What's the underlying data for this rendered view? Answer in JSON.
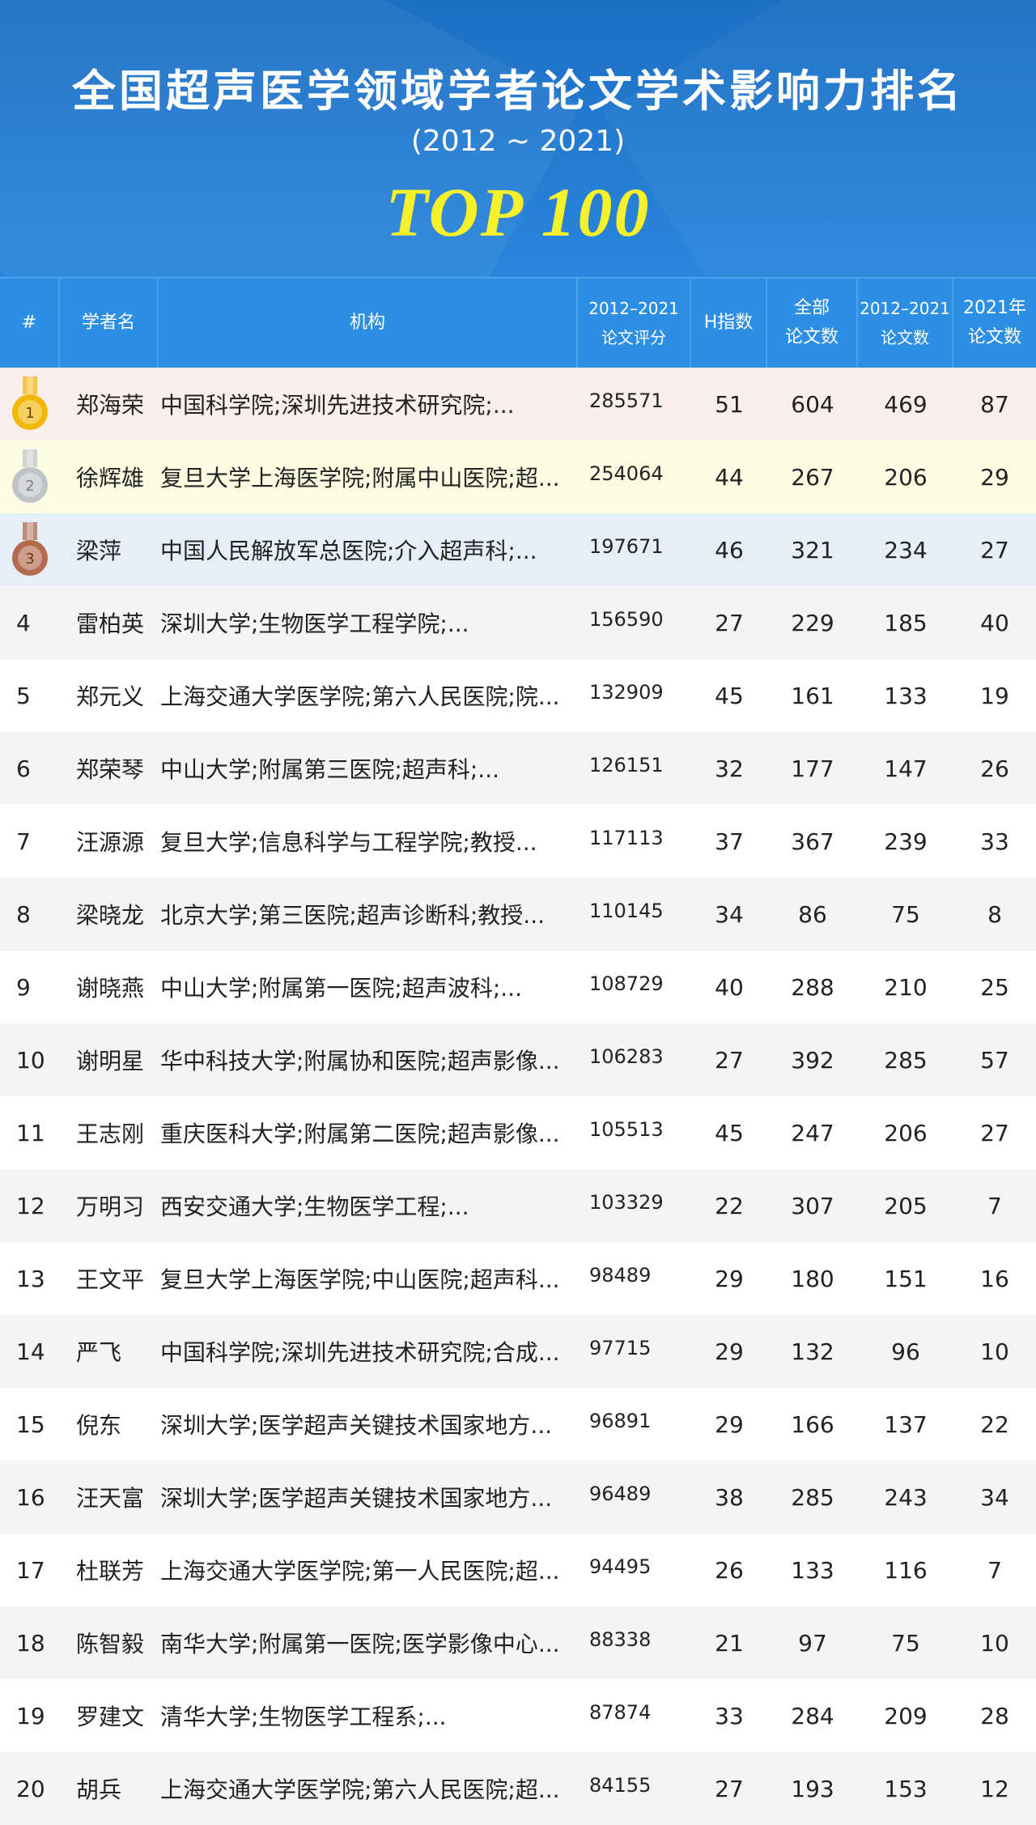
{
  "header": {
    "title": "全国超声医学领域学者论文学术影响力排名",
    "subtitle": "(2012 ~ 2021)",
    "badge": "TOP 100"
  },
  "table": {
    "columns": {
      "rank": "#",
      "name": "学者名",
      "institution": "机构",
      "score_line1": "2012–2021",
      "score_line2": "论文评分",
      "h_index": "H指数",
      "total_line1": "全部",
      "total_line2": "论文数",
      "recent_line1": "2012–2021",
      "recent_line2": "论文数",
      "y2021_line1": "2021年",
      "y2021_line2": "论文数"
    },
    "medal_colors": {
      "gold": "#f2b705",
      "silver": "#c0c4c8",
      "bronze": "#b36a4e"
    },
    "rows": [
      {
        "rank": "1",
        "medal": "gold",
        "name": "郑海荣",
        "institution": "中国科学院;深圳先进技术研究院;...",
        "score": "285571",
        "h": "51",
        "total": "604",
        "recent": "469",
        "y2021": "87"
      },
      {
        "rank": "2",
        "medal": "silver",
        "name": "徐辉雄",
        "institution": "复旦大学上海医学院;附属中山医院;超...",
        "score": "254064",
        "h": "44",
        "total": "267",
        "recent": "206",
        "y2021": "29"
      },
      {
        "rank": "3",
        "medal": "bronze",
        "name": "梁萍",
        "institution": "中国人民解放军总医院;介入超声科;...",
        "score": "197671",
        "h": "46",
        "total": "321",
        "recent": "234",
        "y2021": "27"
      },
      {
        "rank": "4",
        "name": "雷柏英",
        "institution": "深圳大学;生物医学工程学院;...",
        "score": "156590",
        "h": "27",
        "total": "229",
        "recent": "185",
        "y2021": "40"
      },
      {
        "rank": "5",
        "name": "郑元义",
        "institution": "上海交通大学医学院;第六人民医院;院...",
        "score": "132909",
        "h": "45",
        "total": "161",
        "recent": "133",
        "y2021": "19"
      },
      {
        "rank": "6",
        "name": "郑荣琴",
        "institution": "中山大学;附属第三医院;超声科;...",
        "score": "126151",
        "h": "32",
        "total": "177",
        "recent": "147",
        "y2021": "26"
      },
      {
        "rank": "7",
        "name": "汪源源",
        "institution": "复旦大学;信息科学与工程学院;教授...",
        "score": "117113",
        "h": "37",
        "total": "367",
        "recent": "239",
        "y2021": "33"
      },
      {
        "rank": "8",
        "name": "梁晓龙",
        "institution": "北京大学;第三医院;超声诊断科;教授...",
        "score": "110145",
        "h": "34",
        "total": "86",
        "recent": "75",
        "y2021": "8"
      },
      {
        "rank": "9",
        "name": "谢晓燕",
        "institution": "中山大学;附属第一医院;超声波科;...",
        "score": "108729",
        "h": "40",
        "total": "288",
        "recent": "210",
        "y2021": "25"
      },
      {
        "rank": "10",
        "name": "谢明星",
        "institution": "华中科技大学;附属协和医院;超声影像...",
        "score": "106283",
        "h": "27",
        "total": "392",
        "recent": "285",
        "y2021": "57"
      },
      {
        "rank": "11",
        "name": "王志刚",
        "institution": "重庆医科大学;附属第二医院;超声影像...",
        "score": "105513",
        "h": "45",
        "total": "247",
        "recent": "206",
        "y2021": "27"
      },
      {
        "rank": "12",
        "name": "万明习",
        "institution": "西安交通大学;生物医学工程;...",
        "score": "103329",
        "h": "22",
        "total": "307",
        "recent": "205",
        "y2021": "7"
      },
      {
        "rank": "13",
        "name": "王文平",
        "institution": "复旦大学上海医学院;中山医院;超声科...",
        "score": "98489",
        "h": "29",
        "total": "180",
        "recent": "151",
        "y2021": "16"
      },
      {
        "rank": "14",
        "name": "严飞",
        "institution": "中国科学院;深圳先进技术研究院;合成...",
        "score": "97715",
        "h": "29",
        "total": "132",
        "recent": "96",
        "y2021": "10"
      },
      {
        "rank": "15",
        "name": "倪东",
        "institution": "深圳大学;医学超声关键技术国家地方...",
        "score": "96891",
        "h": "29",
        "total": "166",
        "recent": "137",
        "y2021": "22"
      },
      {
        "rank": "16",
        "name": "汪天富",
        "institution": "深圳大学;医学超声关键技术国家地方...",
        "score": "96489",
        "h": "38",
        "total": "285",
        "recent": "243",
        "y2021": "34"
      },
      {
        "rank": "17",
        "name": "杜联芳",
        "institution": "上海交通大学医学院;第一人民医院;超...",
        "score": "94495",
        "h": "26",
        "total": "133",
        "recent": "116",
        "y2021": "7"
      },
      {
        "rank": "18",
        "name": "陈智毅",
        "institution": "南华大学;附属第一医院;医学影像中心...",
        "score": "88338",
        "h": "21",
        "total": "97",
        "recent": "75",
        "y2021": "10"
      },
      {
        "rank": "19",
        "name": "罗建文",
        "institution": "清华大学;生物医学工程系;...",
        "score": "87874",
        "h": "33",
        "total": "284",
        "recent": "209",
        "y2021": "28"
      },
      {
        "rank": "20",
        "name": "胡兵",
        "institution": "上海交通大学医学院;第六人民医院;超...",
        "score": "84155",
        "h": "27",
        "total": "193",
        "recent": "153",
        "y2021": "12"
      }
    ]
  }
}
